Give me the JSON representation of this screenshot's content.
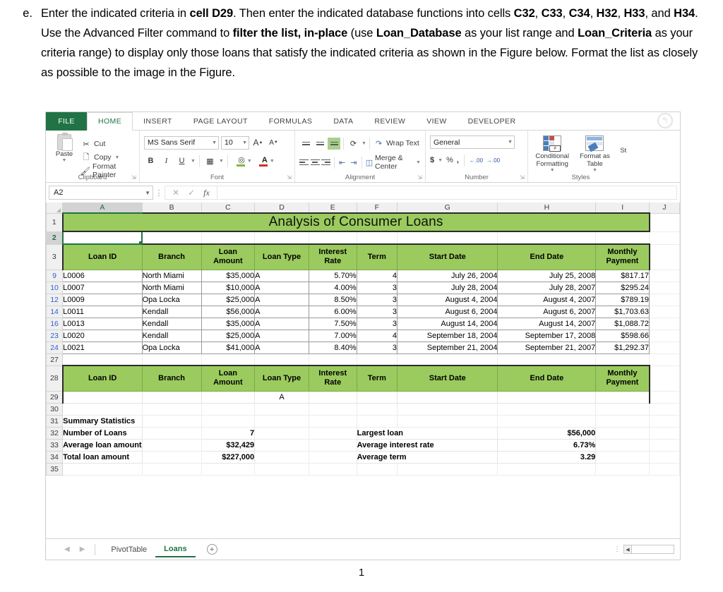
{
  "question": {
    "letter": "e.",
    "segments": [
      {
        "t": "Enter the indicated criteria in ",
        "b": false
      },
      {
        "t": "cell D29",
        "b": true
      },
      {
        "t": ".  Then enter the indicated database functions into cells ",
        "b": false
      },
      {
        "t": "C32",
        "b": true
      },
      {
        "t": ", ",
        "b": false
      },
      {
        "t": "C33",
        "b": true
      },
      {
        "t": ", ",
        "b": false
      },
      {
        "t": "C34",
        "b": true
      },
      {
        "t": ", ",
        "b": false
      },
      {
        "t": "H32",
        "b": true
      },
      {
        "t": ", ",
        "b": false
      },
      {
        "t": "H33",
        "b": true
      },
      {
        "t": ", and ",
        "b": false
      },
      {
        "t": "H34",
        "b": true
      },
      {
        "t": ".  Use the Advanced Filter command to ",
        "b": false
      },
      {
        "t": "filter the list, in-place",
        "b": true
      },
      {
        "t": " (use ",
        "b": false
      },
      {
        "t": "Loan_Database",
        "b": true
      },
      {
        "t": " as your list range and ",
        "b": false
      },
      {
        "t": "Loan_Criteria",
        "b": true
      },
      {
        "t": " as your criteria range) to display only those loans that satisfy the indicated criteria as shown in the Figure below.  Format the list as closely as possible to the image in the Figure.",
        "b": false
      }
    ]
  },
  "excel": {
    "file_tab": "FILE",
    "tabs": [
      "HOME",
      "INSERT",
      "PAGE LAYOUT",
      "FORMULAS",
      "DATA",
      "REVIEW",
      "VIEW",
      "DEVELOPER"
    ],
    "active_tab": "HOME",
    "ribbon": {
      "clipboard": {
        "label": "Clipboard",
        "paste": "Paste",
        "cut": "Cut",
        "copy": "Copy",
        "format_painter": "Format Painter"
      },
      "font": {
        "label": "Font",
        "font_name": "MS Sans Serif",
        "font_size": "10",
        "bold": "B",
        "italic": "I",
        "underline": "U",
        "grow": "A",
        "shrink": "A"
      },
      "alignment": {
        "label": "Alignment",
        "wrap_text": "Wrap Text",
        "merge_center": "Merge & Center"
      },
      "number": {
        "label": "Number",
        "format": "General",
        "currency": "$",
        "percent": "%",
        "comma": ",",
        "increase_decimal": ".00",
        "decrease_decimal": ".00"
      },
      "styles": {
        "label": "Styles",
        "conditional_formatting": "Conditional Formatting",
        "format_as_table": "Format as Table",
        "cell_styles": "St"
      }
    },
    "formula_bar": {
      "name_box": "A2",
      "cancel": "✕",
      "confirm": "✓",
      "fx": "fx",
      "value": ""
    },
    "columns": [
      "A",
      "B",
      "C",
      "D",
      "E",
      "F",
      "G",
      "H",
      "I",
      "J"
    ],
    "selected_column": "A",
    "selected_row": "2",
    "title": "Analysis of Consumer Loans",
    "headers": [
      "Loan ID",
      "Branch",
      "Loan Amount",
      "Loan Type",
      "Interest Rate",
      "Term",
      "Start Date",
      "End Date",
      "Monthly Payment"
    ],
    "header_lines": [
      [
        "",
        "Loan ID"
      ],
      [
        "",
        "Branch"
      ],
      [
        "Loan",
        "Amount"
      ],
      [
        "",
        "Loan Type"
      ],
      [
        "Interest",
        "Rate"
      ],
      [
        "",
        "Term"
      ],
      [
        "",
        "Start Date"
      ],
      [
        "",
        "End Date"
      ],
      [
        "Monthly",
        "Payment"
      ]
    ],
    "rows": [
      {
        "n": "9",
        "cells": [
          "L0006",
          "North Miami",
          "$35,000",
          "A",
          "5.70%",
          "4",
          "July 26, 2004",
          "July 25, 2008",
          "$817.17"
        ]
      },
      {
        "n": "10",
        "cells": [
          "L0007",
          "North Miami",
          "$10,000",
          "A",
          "4.00%",
          "3",
          "July 28, 2004",
          "July 28, 2007",
          "$295.24"
        ]
      },
      {
        "n": "12",
        "cells": [
          "L0009",
          "Opa Locka",
          "$25,000",
          "A",
          "8.50%",
          "3",
          "August 4, 2004",
          "August 4, 2007",
          "$789.19"
        ]
      },
      {
        "n": "14",
        "cells": [
          "L0011",
          "Kendall",
          "$56,000",
          "A",
          "6.00%",
          "3",
          "August 6, 2004",
          "August 6, 2007",
          "$1,703.63"
        ]
      },
      {
        "n": "16",
        "cells": [
          "L0013",
          "Kendall",
          "$35,000",
          "A",
          "7.50%",
          "3",
          "August 14, 2004",
          "August 14, 2007",
          "$1,088.72"
        ]
      },
      {
        "n": "23",
        "cells": [
          "L0020",
          "Kendall",
          "$25,000",
          "A",
          "7.00%",
          "4",
          "September 18, 2004",
          "September 17, 2008",
          "$598.66"
        ]
      },
      {
        "n": "24",
        "cells": [
          "L0021",
          "Opa Locka",
          "$41,000",
          "A",
          "8.40%",
          "3",
          "September 21, 2004",
          "September 21, 2007",
          "$1,292.37"
        ]
      }
    ],
    "criteria": {
      "row_number": "29",
      "loan_type_value": "A"
    },
    "summary": {
      "row31": "31",
      "row32": "32",
      "row33": "33",
      "row34": "34",
      "heading": "Summary Statistics",
      "left": [
        {
          "label": "Number of Loans",
          "value": "7"
        },
        {
          "label": "Average loan amount",
          "value": "$32,429"
        },
        {
          "label": "Total loan amount",
          "value": "$227,000"
        }
      ],
      "right": [
        {
          "label": "Largest loan",
          "value": "$56,000"
        },
        {
          "label": "Average interest rate",
          "value": "6.73%"
        },
        {
          "label": "Average term",
          "value": "3.29"
        }
      ]
    },
    "sheet_tabs": [
      {
        "label": "PivotTable",
        "active": false
      },
      {
        "label": "Loans",
        "active": true
      }
    ],
    "add_sheet": "+",
    "colors": {
      "header_green": "#9bcb5e",
      "excel_green": "#217346",
      "filtered_row_number": "#2f5fd0"
    }
  },
  "page_number": "1"
}
